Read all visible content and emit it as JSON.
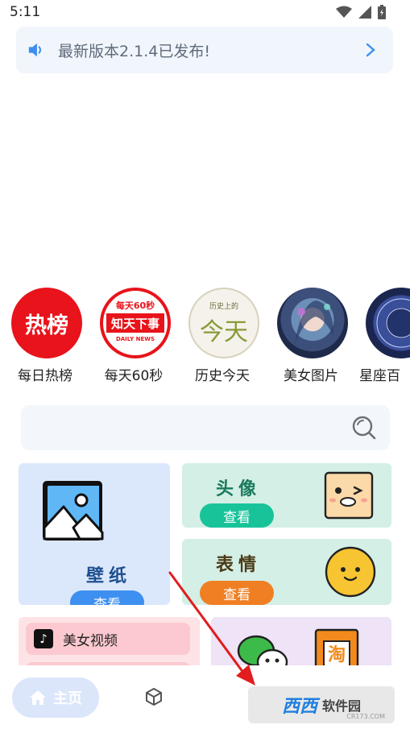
{
  "status_bar": {
    "time": "5:11"
  },
  "notice": {
    "text": "最新版本2.1.4已发布!"
  },
  "quick_nav": [
    {
      "label": "每日热榜",
      "badge": "热榜"
    },
    {
      "label": "每天60秒",
      "badge_top": "每天60秒",
      "badge_main": "知天下事",
      "badge_sub": "DAILY NEWS"
    },
    {
      "label": "历史今天",
      "badge_top": "历史上的",
      "badge_main": "今天"
    },
    {
      "label": "美女图片"
    },
    {
      "label": "星座百"
    }
  ],
  "cards": {
    "wallpaper": {
      "title": "壁纸",
      "button": "查看"
    },
    "avatar": {
      "title": "头像",
      "button": "查看"
    },
    "emoji": {
      "title": "表情",
      "button": "查看"
    }
  },
  "lower_list": {
    "item1": "美女视频"
  },
  "bottom_nav": {
    "home": "主页"
  },
  "watermark": {
    "brand": "西西",
    "site": "软件园",
    "sub": "CR173.COM"
  },
  "colors": {
    "accent_blue": "#3d8ff0",
    "avatar_green": "#19c39a",
    "emoji_orange": "#f07f23",
    "hot_red": "#e8131b"
  }
}
